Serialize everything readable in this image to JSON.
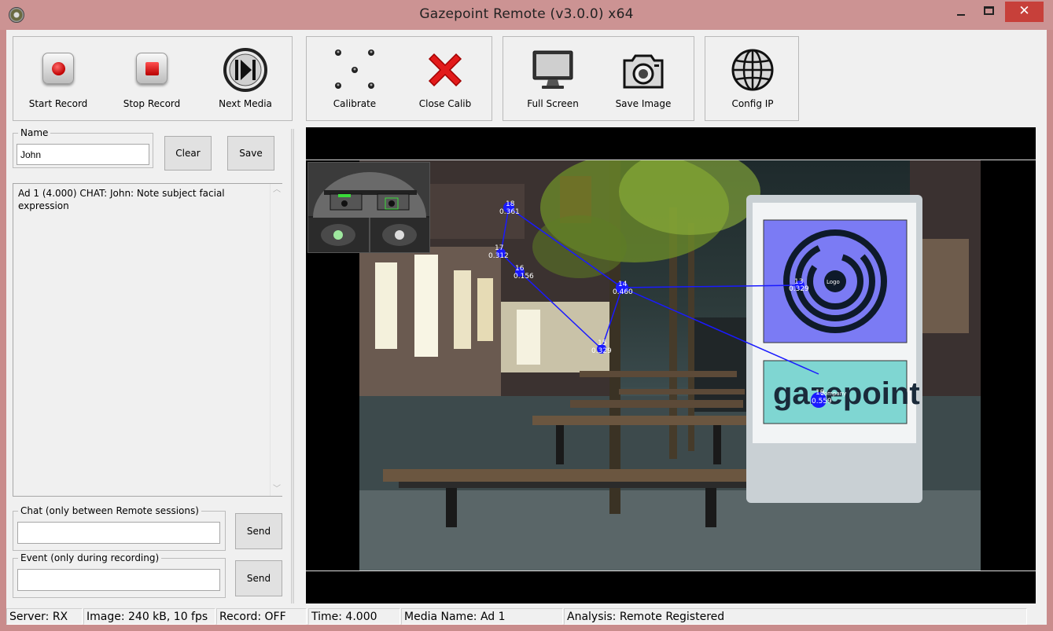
{
  "window": {
    "title": "Gazepoint Remote (v3.0.0)  x64",
    "minimize_glyph": "",
    "close_glyph": "✕"
  },
  "toolbar": {
    "start_record": "Start Record",
    "stop_record": "Stop Record",
    "next_media": "Next Media",
    "calibrate": "Calibrate",
    "close_calib": "Close Calib",
    "full_screen": "Full Screen",
    "save_image": "Save Image",
    "config_ip": "Config IP"
  },
  "name_panel": {
    "legend": "Name",
    "value": "John",
    "clear_label": "Clear",
    "save_label": "Save"
  },
  "log": {
    "text": "Ad 1 (4.000) CHAT: John: Note subject facial expression"
  },
  "chat": {
    "legend": "Chat (only between Remote sessions)",
    "value": "",
    "send_label": "Send"
  },
  "event": {
    "legend": "Event (only during recording)",
    "value": "",
    "send_label": "Send"
  },
  "fixations": [
    {
      "id": "18",
      "dur": "0.361"
    },
    {
      "id": "17",
      "dur": "0.312"
    },
    {
      "id": "16",
      "dur": "0.156"
    },
    {
      "id": "15",
      "dur": "0.329"
    },
    {
      "id": "14",
      "dur": "0.460"
    },
    {
      "id": "13",
      "dur": "0.329"
    },
    {
      "id": "19",
      "dur": "0.559"
    }
  ],
  "scene_labels": {
    "logo_label": "Logo",
    "company_label": "Company",
    "brand_text": "gazepoint"
  },
  "status": {
    "server": "Server: RX",
    "image": "Image: 240 kB, 10 fps",
    "record": "Record: OFF",
    "time": "Time: 4.000",
    "media": "Media Name: Ad 1",
    "analysis": "Analysis: Remote Registered"
  },
  "colors": {
    "title_bar": "#cc9393",
    "close_button": "#c7403a",
    "gaze_path": "#1a1aff",
    "logo_box": "#7b7bf4",
    "company_box": "#7fd6d2"
  }
}
